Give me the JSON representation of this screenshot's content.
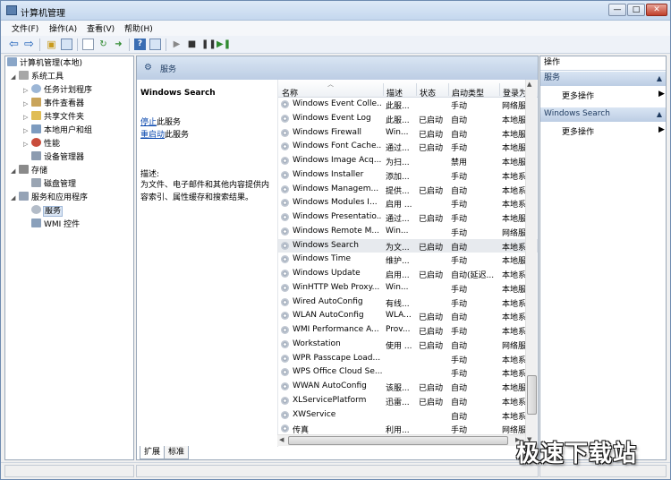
{
  "window": {
    "title": "计算机管理",
    "min": "—",
    "max": "□",
    "close": "✕"
  },
  "menu": [
    "文件(F)",
    "操作(A)",
    "查看(V)",
    "帮助(H)"
  ],
  "toolbar": {
    "icons": [
      "back-icon",
      "forward-icon",
      "up-folder-icon",
      "show-hide-tree-icon",
      "properties-icon",
      "refresh-icon",
      "export-list-icon",
      "help-icon",
      "toggle-view-icon",
      "play-icon",
      "stop-icon",
      "pause-icon",
      "restart-icon"
    ]
  },
  "tree": {
    "root": "计算机管理(本地)",
    "system_tools": "系统工具",
    "task_scheduler": "任务计划程序",
    "event_viewer": "事件查看器",
    "shared_folders": "共享文件夹",
    "local_users": "本地用户和组",
    "performance": "性能",
    "device_manager": "设备管理器",
    "storage": "存储",
    "disk_management": "磁盘管理",
    "services_apps": "服务和应用程序",
    "services": "服务",
    "wmi": "WMI 控件"
  },
  "center": {
    "header_title": "服务",
    "selected_service": "Windows Search",
    "stop_link": "停止",
    "stop_suffix": "此服务",
    "restart_link": "重启动",
    "restart_suffix": "此服务",
    "desc_label": "描述:",
    "description": "为文件、电子邮件和其他内容提供内容索引、属性缓存和搜索结果。"
  },
  "grid": {
    "columns": [
      "名称",
      "描述",
      "状态",
      "启动类型",
      "登录为"
    ],
    "rows": [
      [
        "Windows Event Colle...",
        "此服...",
        "",
        "手动",
        "网络服"
      ],
      [
        "Windows Event Log",
        "此服...",
        "已启动",
        "自动",
        "本地服"
      ],
      [
        "Windows Firewall",
        "Win...",
        "已启动",
        "自动",
        "本地服"
      ],
      [
        "Windows Font Cache...",
        "通过...",
        "已启动",
        "手动",
        "本地服"
      ],
      [
        "Windows Image Acq...",
        "为扫...",
        "",
        "禁用",
        "本地服"
      ],
      [
        "Windows Installer",
        "添加...",
        "",
        "手动",
        "本地系"
      ],
      [
        "Windows Managem...",
        "提供...",
        "已启动",
        "自动",
        "本地系"
      ],
      [
        "Windows Modules I...",
        "启用 ...",
        "",
        "手动",
        "本地系"
      ],
      [
        "Windows Presentatio...",
        "通过...",
        "已启动",
        "手动",
        "本地服"
      ],
      [
        "Windows Remote M...",
        "Win...",
        "",
        "手动",
        "网络服"
      ],
      [
        "Windows Search",
        "为文...",
        "已启动",
        "自动",
        "本地系"
      ],
      [
        "Windows Time",
        "维护...",
        "",
        "手动",
        "本地服"
      ],
      [
        "Windows Update",
        "启用...",
        "已启动",
        "自动(延迟...",
        "本地系"
      ],
      [
        "WinHTTP Web Proxy...",
        "Win...",
        "",
        "手动",
        "本地服"
      ],
      [
        "Wired AutoConfig",
        "有线...",
        "",
        "手动",
        "本地系"
      ],
      [
        "WLAN AutoConfig",
        "WLA...",
        "已启动",
        "自动",
        "本地系"
      ],
      [
        "WMI Performance A...",
        "Prov...",
        "已启动",
        "手动",
        "本地系"
      ],
      [
        "Workstation",
        "使用 ...",
        "已启动",
        "自动",
        "网络服"
      ],
      [
        "WPR Passcape Load...",
        "",
        "",
        "手动",
        "本地系"
      ],
      [
        "WPS Office Cloud Se...",
        "",
        "",
        "手动",
        "本地系"
      ],
      [
        "WWAN AutoConfig",
        "该服...",
        "已启动",
        "自动",
        "本地服"
      ],
      [
        "XLServicePlatform",
        "迅雷...",
        "已启动",
        "自动",
        "本地系"
      ],
      [
        "XWService",
        "",
        "",
        "自动",
        "本地系"
      ],
      [
        "传真",
        "利用...",
        "",
        "手动",
        "网络服"
      ]
    ],
    "selected_index": 10
  },
  "tabs": [
    "扩展",
    "标准"
  ],
  "actions": {
    "header": "操作",
    "services_header": "服务",
    "more_actions_1": "更多操作",
    "search_header": "Windows Search",
    "more_actions_2": "更多操作"
  },
  "watermark": "极速下载站"
}
